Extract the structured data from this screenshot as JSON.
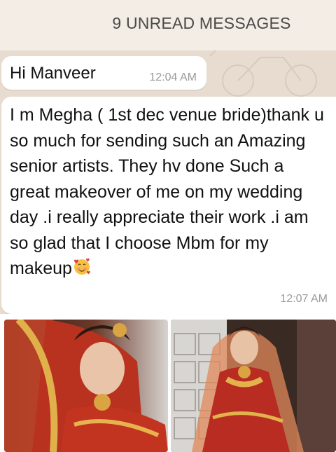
{
  "banner": {
    "unread": "9 UNREAD MESSAGES"
  },
  "messages": [
    {
      "text": "Hi Manveer",
      "time": "12:04 AM"
    },
    {
      "text": "I m Megha ( 1st dec venue bride)thank u so much for sending such an Amazing senior artists. They hv done Such a great makeover of me on my wedding day .i really appreciate their work .i am so glad that I choose Mbm for my makeup",
      "emoji": "smiling-face-with-hearts-icon",
      "time": "12:07 AM"
    }
  ],
  "photos": [
    {
      "name": "bride-closeup-photo"
    },
    {
      "name": "bride-full-photo"
    }
  ],
  "colors": {
    "chat_background": "#e7dccf",
    "banner_background": "#f3ede5",
    "bubble": "#ffffff",
    "timestamp": "#9a9a9a"
  }
}
